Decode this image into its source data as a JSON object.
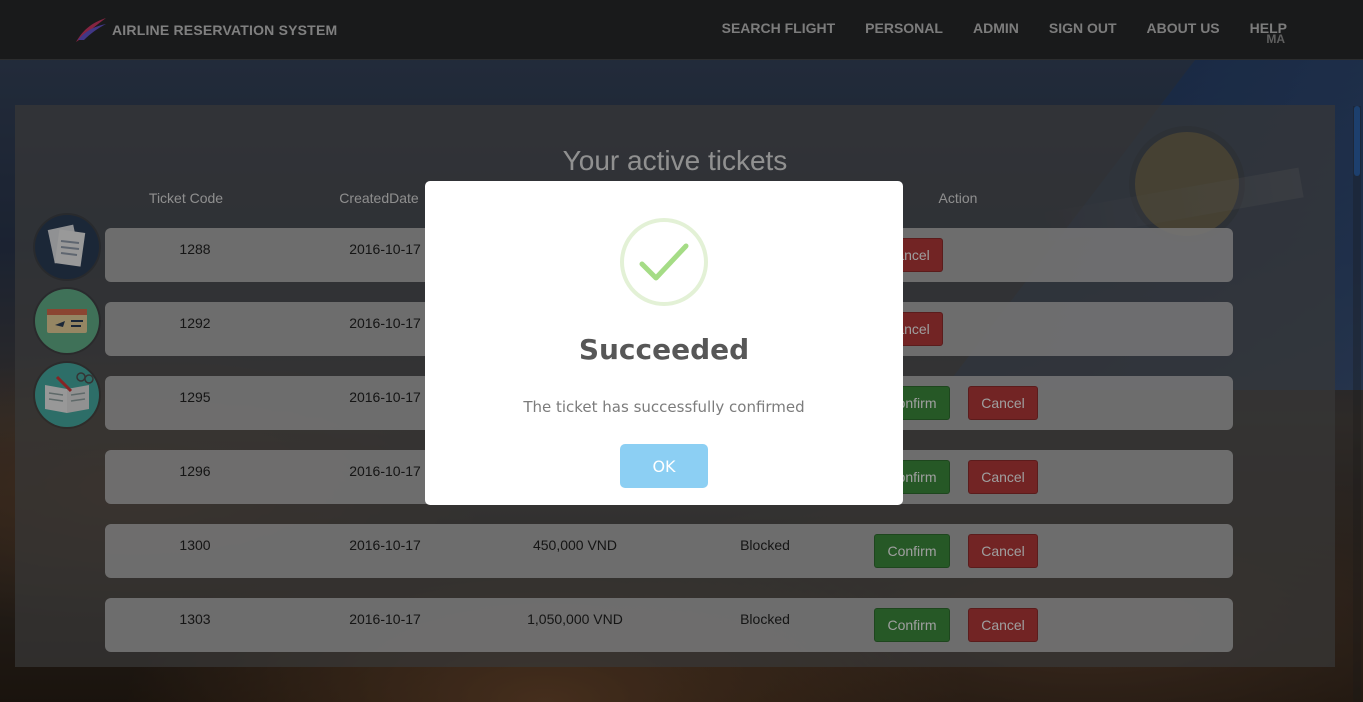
{
  "navbar": {
    "brand": "AIRLINE RESERVATION SYSTEM",
    "links": [
      "SEARCH FLIGHT",
      "PERSONAL",
      "ADMIN",
      "SIGN OUT",
      "ABOUT US",
      "HELP"
    ],
    "user_initials": "MA"
  },
  "page": {
    "title": "Your active tickets",
    "columns": [
      "Ticket Code",
      "CreatedDate",
      "Action"
    ]
  },
  "tickets": [
    {
      "code": "1288",
      "date": "2016-10-17",
      "price": "",
      "status": "",
      "confirm": "",
      "cancel": "Cancel"
    },
    {
      "code": "1292",
      "date": "2016-10-17",
      "price": "",
      "status": "",
      "confirm": "",
      "cancel": "Cancel"
    },
    {
      "code": "1295",
      "date": "2016-10-17",
      "price": "",
      "status": "",
      "confirm": "Confirm",
      "cancel": "Cancel"
    },
    {
      "code": "1296",
      "date": "2016-10-17",
      "price": "",
      "status": "",
      "confirm": "Confirm",
      "cancel": "Cancel"
    },
    {
      "code": "1300",
      "date": "2016-10-17",
      "price": "450,000 VND",
      "status": "Blocked",
      "confirm": "Confirm",
      "cancel": "Cancel"
    },
    {
      "code": "1303",
      "date": "2016-10-17",
      "price": "1,050,000 VND",
      "status": "Blocked",
      "confirm": "Confirm",
      "cancel": "Cancel"
    }
  ],
  "side_icons": [
    "documents-icon",
    "ticket-icon",
    "book-icon"
  ],
  "modal": {
    "title": "Succeeded",
    "message": "The ticket has successfully confirmed",
    "ok_label": "OK"
  },
  "colors": {
    "confirm": "#3e8f3e",
    "cancel": "#b93a3a",
    "ok": "#8ccff3",
    "check": "#a5dc86"
  }
}
